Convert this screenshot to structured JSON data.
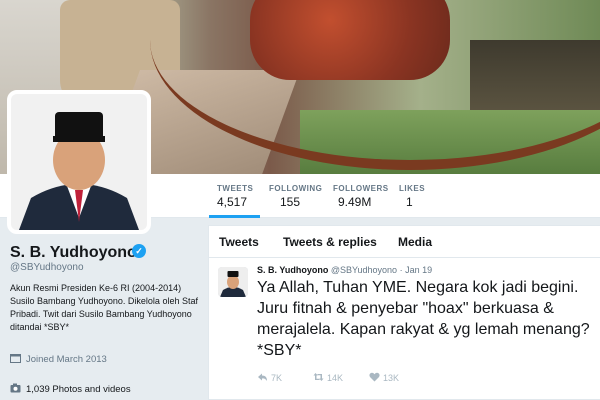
{
  "profile": {
    "name": "S. B. Yudhoyono",
    "handle": "@SBYudhoyono",
    "bio": "Akun Resmi Presiden Ke-6 RI (2004-2014) Susilo Bambang Yudhoyono. Dikelola oleh Staf Pribadi. Twit dari Susilo Bambang Yudhoyono ditandai *SBY*",
    "joined": "Joined March 2013",
    "photos": "1,039 Photos and videos"
  },
  "stats": [
    {
      "label": "TWEETS",
      "value": "4,517"
    },
    {
      "label": "FOLLOWING",
      "value": "155"
    },
    {
      "label": "FOLLOWERS",
      "value": "9.49M"
    },
    {
      "label": "LIKES",
      "value": "1"
    }
  ],
  "tabs": [
    "Tweets",
    "Tweets & replies",
    "Media"
  ],
  "tweet": {
    "name": "S. B. Yudhoyono",
    "handle": "@SBYudhoyono",
    "date": "Jan 19",
    "text": "Ya Allah, Tuhan YME. Negara kok jadi begini. Juru fitnah & penyebar \"hoax\" berkuasa & merajalela. Kapan rakyat & yg lemah menang? *SBY*",
    "replies": "7K",
    "retweets": "14K",
    "likes": "13K"
  },
  "colors": {
    "accent": "#1da1f2",
    "muted": "#657786",
    "background": "#e6ecf0"
  },
  "icons": {
    "verified": "verified-badge-icon",
    "calendar": "calendar-icon",
    "camera": "camera-icon",
    "reply": "reply-icon",
    "retweet": "retweet-icon",
    "like": "heart-icon"
  }
}
